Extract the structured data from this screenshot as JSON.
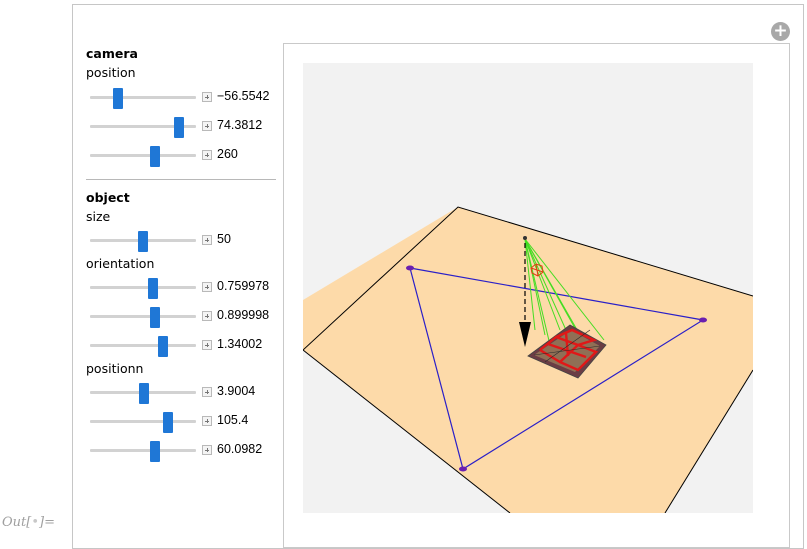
{
  "camera": {
    "title": "camera",
    "position_label": "position",
    "sliders": [
      {
        "value": "−56.5542",
        "fraction": 0.24
      },
      {
        "value": "74.3812",
        "fraction": 0.87
      },
      {
        "value": "260",
        "fraction": 0.63
      }
    ]
  },
  "object": {
    "title": "object",
    "size_label": "size",
    "size_slider": {
      "value": "50",
      "fraction": 0.5
    },
    "orientation_label": "orientation",
    "orientation_sliders": [
      {
        "value": "0.759978",
        "fraction": 0.6
      },
      {
        "value": "0.899998",
        "fraction": 0.63
      },
      {
        "value": "1.34002",
        "fraction": 0.71
      }
    ],
    "positionn_label": "positionn",
    "positionn_sliders": [
      {
        "value": "3.9004",
        "fraction": 0.51
      },
      {
        "value": "105.4",
        "fraction": 0.76
      },
      {
        "value": "60.0982",
        "fraction": 0.63
      }
    ]
  },
  "output": {
    "prefix": "Out[",
    "suffix": "]="
  },
  "colors": {
    "slider_thumb": "#1f77d6",
    "floor": "#fddaa9",
    "triangle": "#2a1fc8",
    "rays": "#44dd22",
    "object_lines": "#e01818"
  },
  "icons": {
    "add": "circle-plus-icon",
    "slider_plus": "plus-square-icon"
  }
}
